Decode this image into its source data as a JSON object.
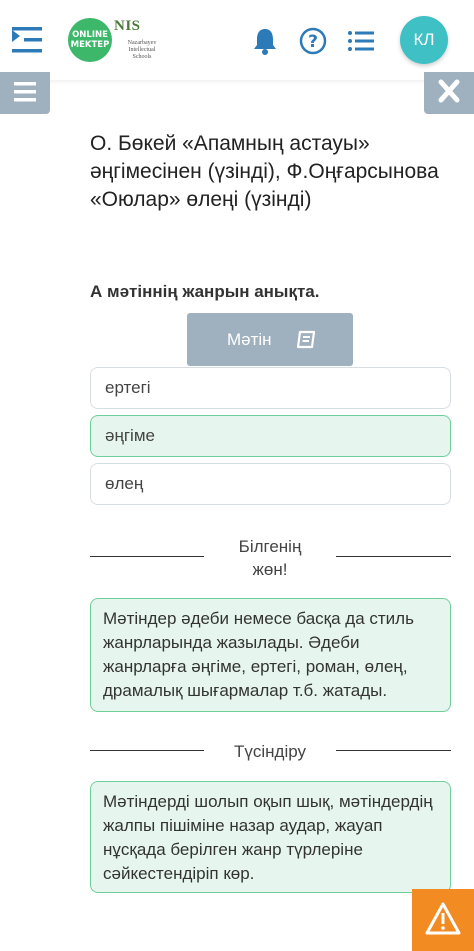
{
  "header": {
    "logo_line1": "ONLINE",
    "logo_line2": "MEKTEP",
    "nis_mark": "NIS",
    "nis_subtitle": "Nazarbayev Intellectual Schools",
    "avatar_initials": "КЛ",
    "accent_color": "#3ec0c4"
  },
  "content": {
    "title": "О. Бөкей «Апамның астауы» әңгімесінен (үзінді), Ф.Оңғарсынова «Оюлар» өлеңі (үзінді)",
    "question": "А мәтіннің жанрын анықта.",
    "text_button_label": "Мәтін",
    "options": [
      {
        "label": "ертегі",
        "selected": false
      },
      {
        "label": "әңгіме",
        "selected": true
      },
      {
        "label": "өлең",
        "selected": false
      }
    ]
  },
  "hint": {
    "heading": "Білгенің жөн!",
    "text": "Мәтіндер әдеби немесе басқа да стиль жанрларында жазылады. Әдеби жанрларға әңгіме, ертегі, роман, өлең, драмалық шығармалар т.б. жатады."
  },
  "explanation": {
    "heading": "Түсіндіру",
    "text": "Мәтіндерді шолып оқып шық, мәтіндердің жалпы пішіміне назар аудар, жауап нұсқада берілген жанр түрлеріне сәйкестендіріп көр."
  },
  "colors": {
    "brand_green": "#3db86a",
    "button_gray": "#9fb0be",
    "selected_bg": "#e6f6ee",
    "selected_border": "#6fcf9a",
    "warning": "#f28c22"
  }
}
